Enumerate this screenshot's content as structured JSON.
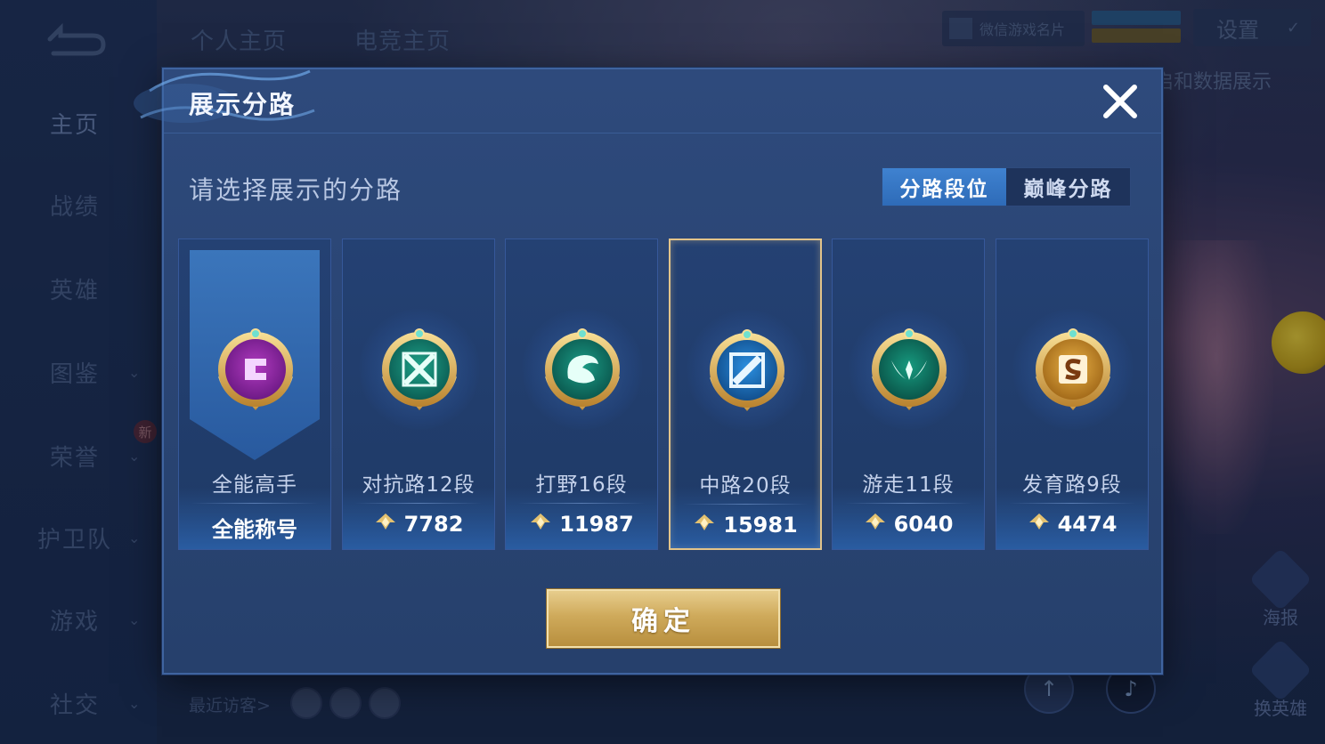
{
  "background": {
    "tabs": [
      "个人主页",
      "电竞主页"
    ],
    "sidebar": [
      {
        "label": "主页",
        "has_chevron": false,
        "active": true
      },
      {
        "label": "战绩",
        "has_chevron": false,
        "active": false
      },
      {
        "label": "英雄",
        "has_chevron": false,
        "active": false
      },
      {
        "label": "图鉴",
        "has_chevron": true,
        "active": false
      },
      {
        "label": "荣誉",
        "has_chevron": true,
        "active": false
      },
      {
        "label": "护卫队",
        "has_chevron": true,
        "active": false
      },
      {
        "label": "游戏",
        "has_chevron": true,
        "active": false
      },
      {
        "label": "社交",
        "has_chevron": true,
        "active": false
      }
    ],
    "new_badge": "新",
    "wechat_card": "微信游戏名片",
    "settings": "设置",
    "data_display": "启和数据展示",
    "recent_visitors": "最近访客>",
    "side_actions": [
      "海报",
      "换英雄"
    ],
    "chevron_glyph": "⌄",
    "check_glyph": "✓",
    "tiktok_glyph": "♪",
    "upload_glyph": "↑"
  },
  "modal": {
    "title": "展示分路",
    "subtitle": "请选择展示的分路",
    "segments": [
      {
        "label": "分路段位",
        "active": true
      },
      {
        "label": "巅峰分路",
        "active": false
      }
    ],
    "cards": [
      {
        "name": "全能高手",
        "score": "全能称号",
        "show_score_icon": false,
        "emblem": "crown-purple",
        "selected": false,
        "banner": true
      },
      {
        "name": "对抗路12段",
        "score": "7782",
        "show_score_icon": true,
        "emblem": "clash-lane-green",
        "selected": false,
        "banner": false
      },
      {
        "name": "打野16段",
        "score": "11987",
        "show_score_icon": true,
        "emblem": "jungle-dragon-teal",
        "selected": false,
        "banner": false
      },
      {
        "name": "中路20段",
        "score": "15981",
        "show_score_icon": true,
        "emblem": "mid-lane-blue",
        "selected": true,
        "banner": false
      },
      {
        "name": "游走11段",
        "score": "6040",
        "show_score_icon": true,
        "emblem": "roam-wings-teal",
        "selected": false,
        "banner": false
      },
      {
        "name": "发育路9段",
        "score": "4474",
        "show_score_icon": true,
        "emblem": "farm-lane-gold",
        "selected": false,
        "banner": false
      }
    ],
    "confirm": "确定"
  },
  "colors": {
    "accent_blue": "#3f82d0",
    "gold": "#cfaa5b",
    "selected_border": "#e3c48a"
  }
}
